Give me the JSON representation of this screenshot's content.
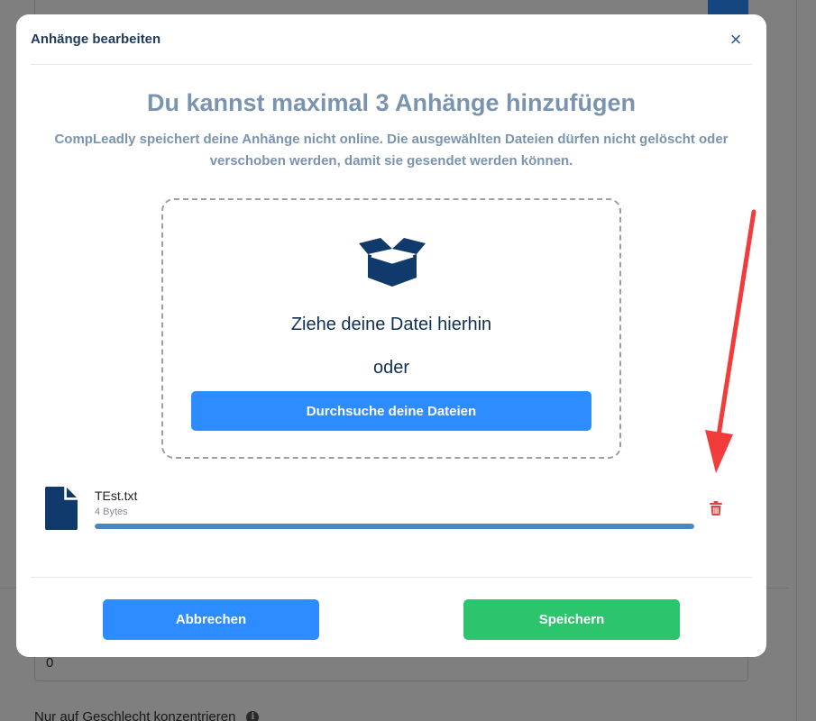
{
  "background": {
    "input_value": "0",
    "field_label": "Nur auf Geschlecht konzentrieren",
    "info_icon": "i"
  },
  "modal": {
    "title": "Anhänge bearbeiten",
    "close_label": "×",
    "headline": "Du kannst maximal 3 Anhänge hinzufügen",
    "subtext": "CompLeadly speichert deine Anhänge nicht online. Die ausgewählten Dateien dürfen nicht gelöscht oder verschoben werden, damit sie gesendet werden können.",
    "dropzone": {
      "icon": "open-box-icon",
      "drop_text": "Ziehe deine Datei hierhin",
      "or_text": "oder",
      "browse_label": "Durchsuche deine Dateien"
    },
    "file": {
      "icon": "file-icon",
      "name": "TEst.txt",
      "size": "4 Bytes",
      "upload_progress": 1.0,
      "delete_icon": "trash-icon"
    },
    "buttons": {
      "cancel_label": "Abbrechen",
      "save_label": "Speichern"
    }
  },
  "colors": {
    "primary": "#2d8cff",
    "success": "#2cc56e",
    "danger": "#e04545",
    "navy": "#0f3a6b",
    "headline": "#7a94b0",
    "annotation": "#f23b3b"
  }
}
